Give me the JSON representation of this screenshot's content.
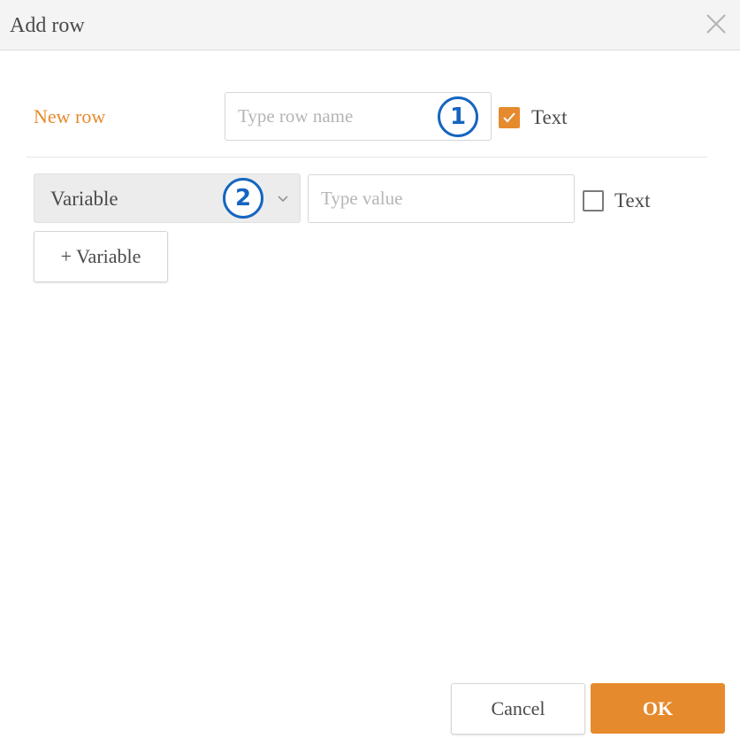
{
  "dialog": {
    "title": "Add row"
  },
  "row": {
    "label": "New row",
    "name_placeholder": "Type row name",
    "name_value": "",
    "badge": "1",
    "text_checkbox_label": "Text",
    "text_checked": true
  },
  "variable": {
    "select_value": "Variable",
    "badge": "2",
    "value_placeholder": "Type value",
    "value": "",
    "text_checkbox_label": "Text",
    "text_checked": false,
    "add_button_label": "+ Variable"
  },
  "footer": {
    "cancel_label": "Cancel",
    "ok_label": "OK"
  },
  "colors": {
    "accent": "#e68a2e",
    "badge": "#1565c0"
  },
  "icons": {
    "close": "close-icon",
    "check": "checkmark-icon",
    "dropdown": "chevron-down-icon"
  }
}
